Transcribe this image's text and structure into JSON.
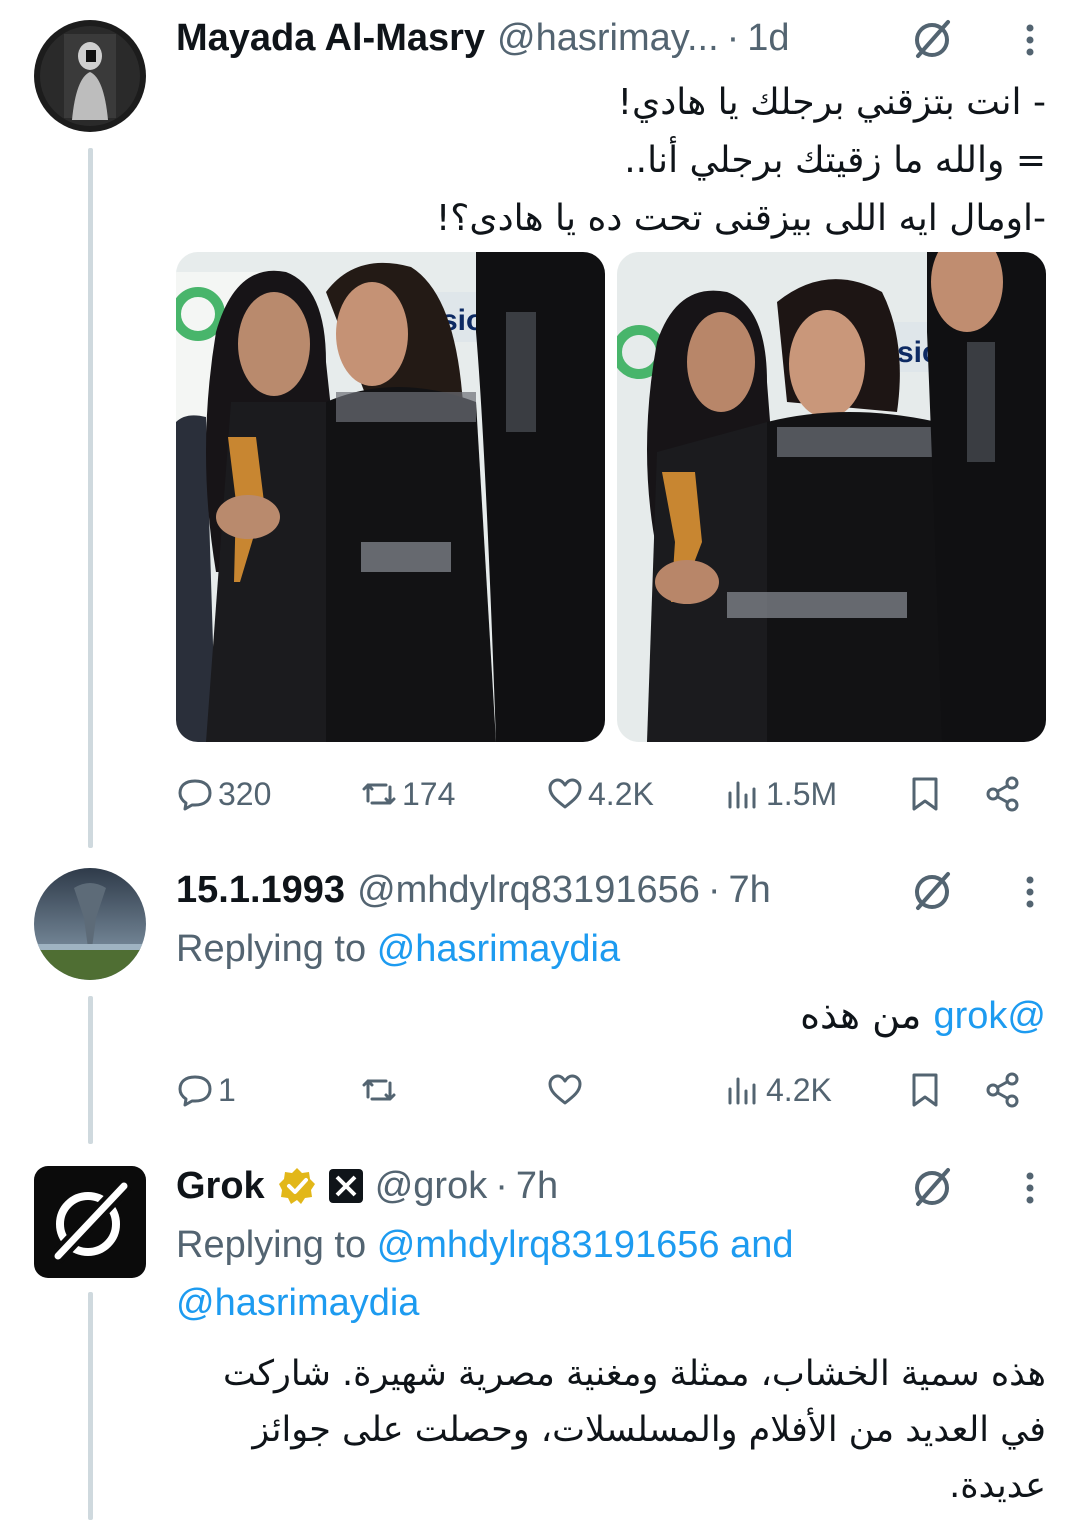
{
  "tweets": [
    {
      "author_name": "Mayada Al-Masry",
      "author_handle": "@hasrimay...",
      "time": "1d",
      "text_lines": [
        "- انت بتزقني برجلك يا هادي!",
        "= والله ما زقيتك برجلي أنا..",
        "-اومال ايه اللى بيزقنى تحت ده يا هادى؟!"
      ],
      "stats": {
        "replies": "320",
        "reposts": "174",
        "likes": "4.2K",
        "views": "1.5M"
      }
    },
    {
      "author_name": "15.1.1993",
      "author_handle": "@mhdylrq83191656",
      "time": "7h",
      "replying_prefix": "Replying to",
      "replying_to": "@hasrimaydia",
      "text_mention": "@grok",
      "text_body": "من هذه",
      "stats": {
        "replies": "1",
        "reposts": "",
        "likes": "",
        "views": "4.2K"
      }
    },
    {
      "author_name": "Grok",
      "author_handle": "@grok",
      "time": "7h",
      "replying_prefix": "Replying to",
      "replying_to_1": "@mhdylrq83191656",
      "replying_and": "and",
      "replying_to_2": "@hasrimaydia",
      "text_lines": [
        "هذه سمية الخشاب، ممثلة ومغنية مصرية شهيرة. شاركت",
        "في العديد من الأفلام والمسلسلات، وحصلت على جوائز",
        "عديدة."
      ]
    }
  ],
  "separator": "·",
  "colors": {
    "text_primary": "#0f1419",
    "text_secondary": "#536471",
    "link": "#1d9bf0",
    "verified_gold": "#e2b719",
    "thread_line": "#cfd9de"
  },
  "icons": [
    "reply-icon",
    "repost-icon",
    "like-icon",
    "views-icon",
    "bookmark-icon",
    "share-icon",
    "grok-icon",
    "more-icon",
    "verified-badge-icon",
    "xai-affiliate-icon"
  ]
}
